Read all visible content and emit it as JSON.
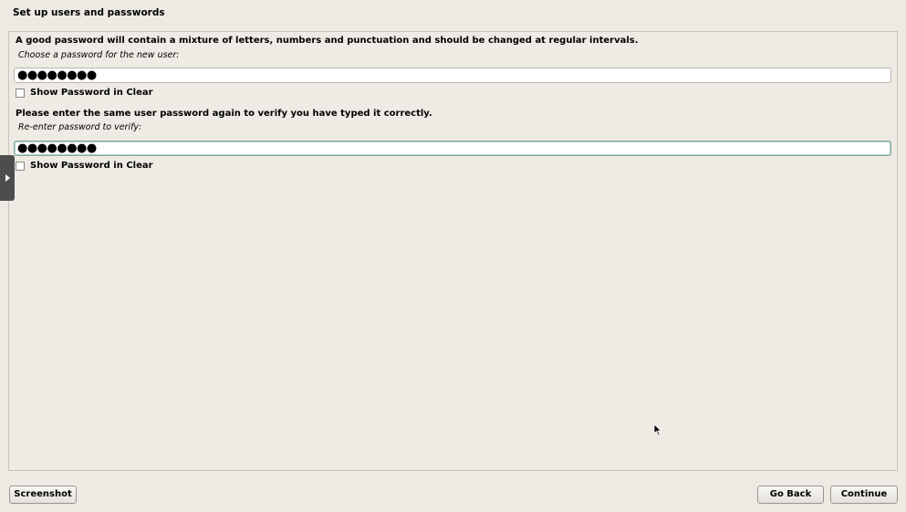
{
  "header": {
    "title": "Set up users and passwords"
  },
  "main": {
    "intro": "A good password will contain a mixture of letters, numbers and punctuation and should be changed at regular intervals.",
    "password_prompt": "Choose a password for the new user:",
    "password_value": "●●●●●●●●",
    "show_password_label_1": "Show Password in Clear",
    "verify_intro": "Please enter the same user password again to verify you have typed it correctly.",
    "verify_prompt": "Re-enter password to verify:",
    "verify_value": "●●●●●●●●",
    "show_password_label_2": "Show Password in Clear"
  },
  "footer": {
    "screenshot_label": "Screenshot",
    "go_back_label": "Go Back",
    "continue_label": "Continue"
  },
  "icons": {
    "side_handle": "chevron-right-icon",
    "cursor": "mouse-pointer-icon"
  }
}
